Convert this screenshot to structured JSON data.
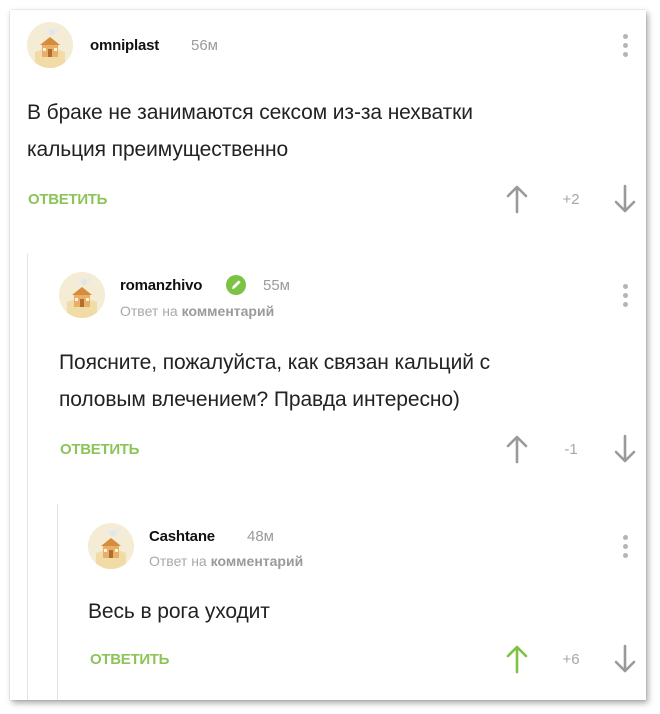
{
  "colors": {
    "accent_green": "#8dc45a",
    "upvoted_green": "#7cc243",
    "muted_gray": "#9b9b9b",
    "arrow_gray": "#9a9a9a"
  },
  "comments": [
    {
      "username": "omniplast",
      "time": "56м",
      "text_lines": [
        "В браке не занимаются сексом из-за нехватки",
        "кальция преимущественно"
      ],
      "reply_label": "ОТВЕТИТЬ",
      "rating": "+2",
      "upvoted": false,
      "verified": false,
      "avatar_icon": "default-house-avatar",
      "more_icon": "vertical-dots-icon"
    },
    {
      "username": "romanzhivo",
      "time": "55м",
      "reply_prefix": "Ответ на",
      "reply_link": "комментарий",
      "text_lines": [
        "Поясните, пожалуйста, как связан кальций с",
        "половым влечением? Правда интересно)"
      ],
      "reply_label": "ОТВЕТИТЬ",
      "rating": "-1",
      "upvoted": false,
      "verified": true,
      "badge_icon": "pencil-icon",
      "avatar_icon": "default-house-avatar",
      "more_icon": "vertical-dots-icon"
    },
    {
      "username": "Cashtane",
      "time": "48м",
      "reply_prefix": "Ответ на",
      "reply_link": "комментарий",
      "text_lines": [
        "Весь в рога уходит"
      ],
      "reply_label": "ОТВЕТИТЬ",
      "rating": "+6",
      "upvoted": true,
      "verified": false,
      "avatar_icon": "default-house-avatar",
      "more_icon": "vertical-dots-icon"
    }
  ]
}
